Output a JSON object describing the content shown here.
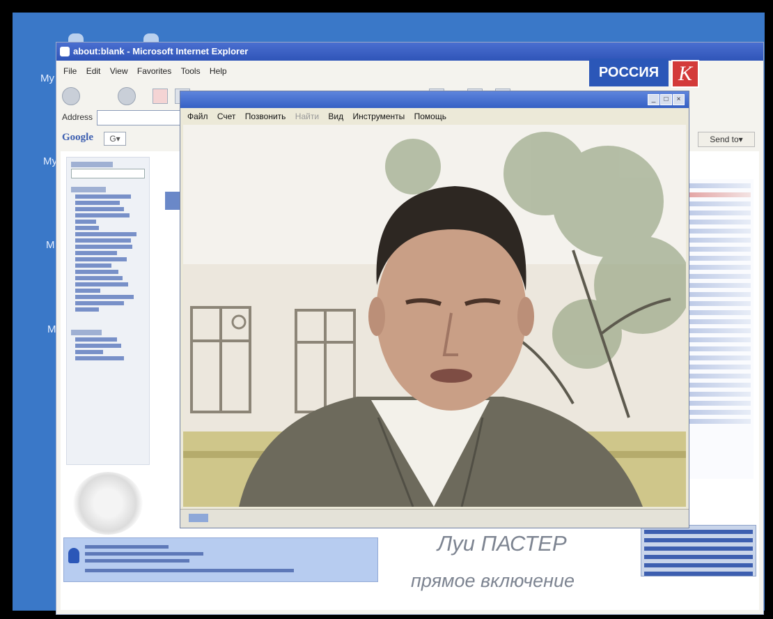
{
  "channel_logo": {
    "text": "РОССИЯ",
    "letter": "К"
  },
  "desktop": {
    "labels": [
      "My",
      "My",
      "M",
      "M"
    ]
  },
  "ie": {
    "title": "about:blank - Microsoft Internet Explorer",
    "menu": [
      "File",
      "Edit",
      "View",
      "Favorites",
      "Tools",
      "Help"
    ],
    "address_label": "Address",
    "google_label": "Google",
    "google_button": "G▾",
    "send_to": "Send to▾"
  },
  "player": {
    "menu": [
      "Файл",
      "Счет",
      "Позвонить",
      "Найти",
      "Вид",
      "Инструменты",
      "Помощь"
    ],
    "controls": [
      "_",
      "□",
      "×"
    ]
  },
  "caption": {
    "name": "Луи ПАСТЕР",
    "subtitle": "прямое включение"
  },
  "colors": {
    "desktop": "#3a78c8",
    "logo_blue": "#2b57b8",
    "logo_red": "#d33a3a",
    "caption": "#7d8491"
  }
}
